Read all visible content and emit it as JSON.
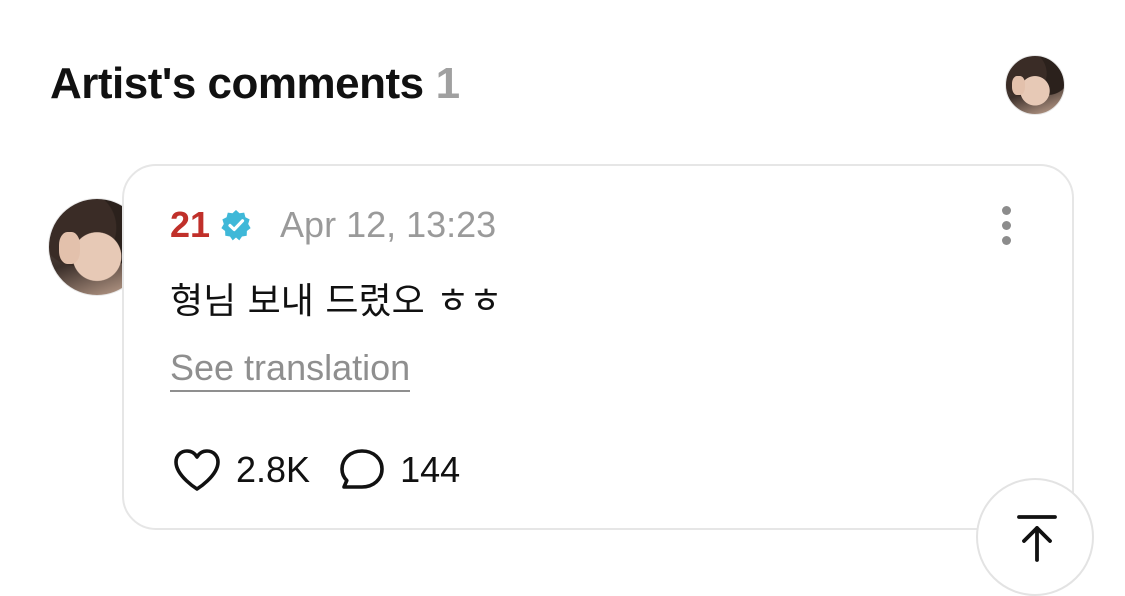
{
  "header": {
    "title": "Artist's comments",
    "count": "1"
  },
  "comment": {
    "author": "21",
    "timestamp": "Apr 12, 13:23",
    "text": "형님 보내 드렸오 ㅎㅎ",
    "translate_label": "See translation",
    "likes": "2.8K",
    "replies": "144"
  },
  "icons": {
    "verified": "verified-badge-icon",
    "more": "more-vertical-icon",
    "like": "heart-icon",
    "reply": "speech-bubble-icon",
    "scroll_top": "arrow-up-to-top-icon"
  },
  "colors": {
    "author": "#c0302a",
    "verified": "#3fb8d8",
    "muted": "#9a9a9a",
    "count": "#a0a0a0"
  }
}
